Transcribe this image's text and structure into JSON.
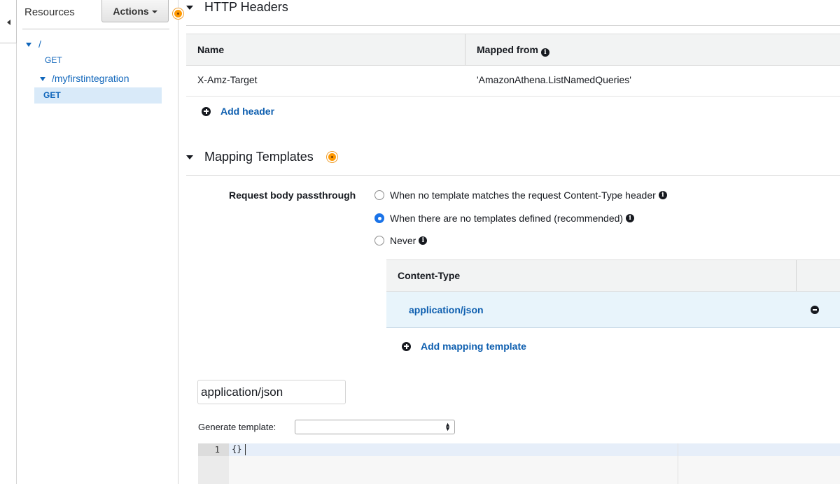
{
  "sidebar": {
    "title": "Resources",
    "actions_label": "Actions",
    "tree": {
      "root_path": "/",
      "root_method": "GET",
      "child_path": "/myfirstintegration",
      "child_method": "GET"
    }
  },
  "http_headers": {
    "title": "HTTP Headers",
    "columns": [
      "Name",
      "Mapped from"
    ],
    "rows": [
      {
        "name": "X-Amz-Target",
        "mapped_from": "'AmazonAthena.ListNamedQueries'"
      }
    ],
    "add_label": "Add header"
  },
  "mapping_templates": {
    "title": "Mapping Templates",
    "passthrough_label": "Request body passthrough",
    "options": [
      {
        "label": "When no template matches the request Content-Type header",
        "selected": false
      },
      {
        "label": "When there are no templates defined (recommended)",
        "selected": true
      },
      {
        "label": "Never",
        "selected": false
      }
    ],
    "content_type_header": "Content-Type",
    "content_types": [
      "application/json"
    ],
    "add_label": "Add mapping template",
    "selected_content_type": "application/json",
    "generate_label": "Generate template:",
    "generate_value": "",
    "editor": {
      "line_number": "1",
      "code": "{}"
    }
  },
  "colors": {
    "link": "#0d5eaf",
    "status_dot": "#ff9900",
    "selected_row": "#e8f4fb",
    "radio_selected": "#1a73e8"
  }
}
